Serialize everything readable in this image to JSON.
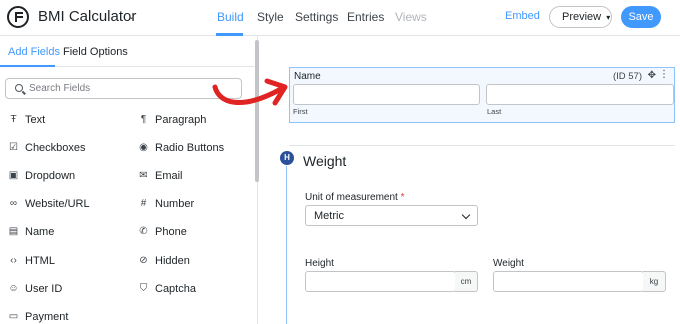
{
  "header": {
    "form_title": "BMI Calculator",
    "nav": [
      "Build",
      "Style",
      "Settings",
      "Entries",
      "Views"
    ],
    "active_nav": "Build",
    "embed_label": "Embed",
    "preview_label": "Preview",
    "save_label": "Save",
    "accent_color": "#4199fd"
  },
  "sidebar": {
    "tabs": [
      "Add Fields",
      "Field Options"
    ],
    "active_tab": "Add Fields",
    "search_placeholder": "Search Fields",
    "fields_left": [
      {
        "label": "Text",
        "icon": "text-icon"
      },
      {
        "label": "Checkboxes",
        "icon": "checkbox-icon"
      },
      {
        "label": "Dropdown",
        "icon": "dropdown-icon"
      },
      {
        "label": "Website/URL",
        "icon": "link-icon"
      },
      {
        "label": "Name",
        "icon": "id-card-icon"
      },
      {
        "label": "HTML",
        "icon": "code-icon"
      },
      {
        "label": "User ID",
        "icon": "user-icon"
      },
      {
        "label": "Payment",
        "icon": "payment-icon"
      }
    ],
    "fields_right": [
      {
        "label": "Paragraph",
        "icon": "paragraph-icon"
      },
      {
        "label": "Radio Buttons",
        "icon": "radio-icon"
      },
      {
        "label": "Email",
        "icon": "email-icon"
      },
      {
        "label": "Number",
        "icon": "hash-icon"
      },
      {
        "label": "Phone",
        "icon": "phone-icon"
      },
      {
        "label": "Hidden",
        "icon": "eye-slash-icon"
      },
      {
        "label": "Captcha",
        "icon": "shield-icon"
      }
    ]
  },
  "canvas": {
    "name_field": {
      "label": "Name",
      "id_text": "(ID 57)",
      "first_label": "First",
      "last_label": "Last"
    },
    "section": {
      "badge": "H",
      "title": "Weight"
    },
    "unit_field": {
      "label": "Unit of measurement",
      "required_mark": "*",
      "value": "Metric"
    },
    "height_field": {
      "label": "Height",
      "unit": "cm"
    },
    "weight_field": {
      "label": "Weight",
      "unit": "kg"
    }
  }
}
